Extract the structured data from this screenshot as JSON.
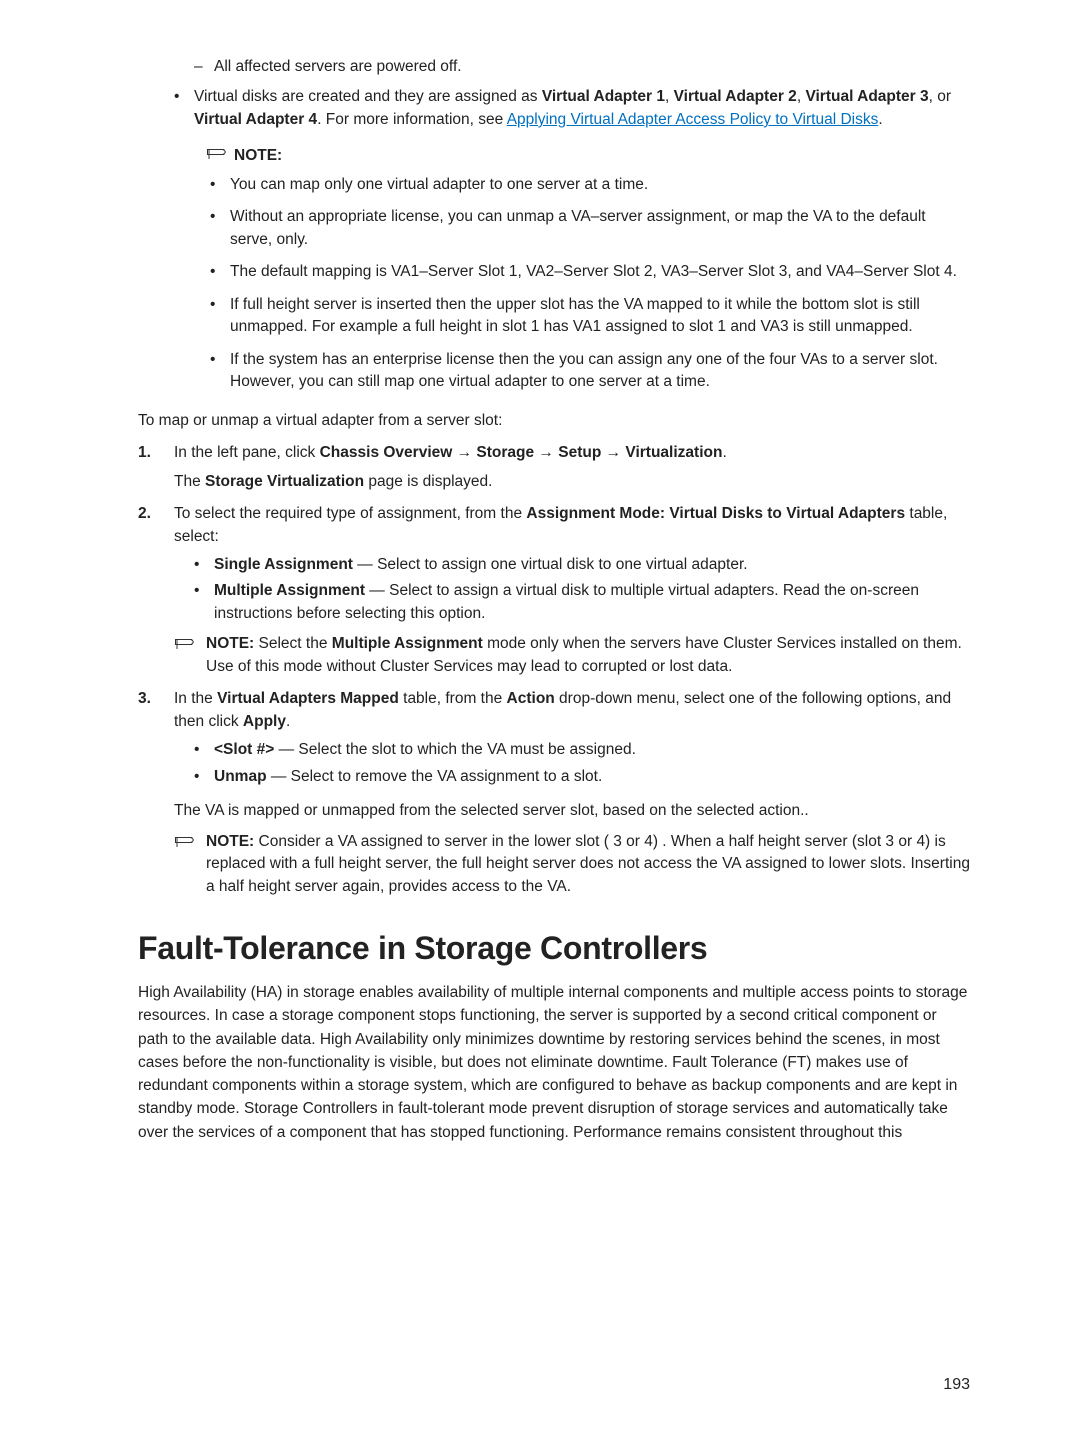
{
  "icons": {
    "pencil_alt": "Note pencil icon"
  },
  "sublist": {
    "item1": "All affected servers are powered off."
  },
  "top": {
    "vd_pre": "Virtual disks are created and they are assigned as ",
    "va1": "Virtual Adapter 1",
    "va2": "Virtual Adapter 2",
    "va3": "Virtual Adapter 3",
    "va4": "Virtual Adapter 4",
    "more_info": ". For more information, see ",
    "link_text": "Applying Virtual Adapter Access Policy to Virtual Disks",
    "period": "."
  },
  "note1": {
    "label": "NOTE:",
    "items": [
      "You can map only one virtual adapter to one server at a time.",
      "Without an appropriate license, you can unmap a VA–server assignment, or map the VA to the default serve, only.",
      "The default mapping is VA1–Server Slot 1, VA2–Server Slot 2, VA3–Server Slot 3, and VA4–Server Slot 4.",
      "If full height server is inserted then the upper slot has the VA mapped to it while the bottom slot is still unmapped. For example a full height in slot 1 has VA1 assigned to slot 1 and VA3 is still unmapped.",
      "If the system has an enterprise license then the you can assign any one of the four VAs to a server slot. However, you can still map one virtual adapter to one server at a time."
    ]
  },
  "intro": "To map or unmap a virtual adapter from a server slot:",
  "steps": {
    "s1": {
      "pre": "In the left pane, click ",
      "path": "Chassis Overview → Storage → Setup → Virtualization",
      "post": ".",
      "line2_pre": "The ",
      "line2_bold": "Storage Virtualization",
      "line2_post": " page is displayed."
    },
    "s2": {
      "pre": "To select the required type of assignment, from the ",
      "bold1": "Assignment Mode: Virtual Disks to Virtual Adapters",
      "post": " table, select:",
      "b1_lbl": "Single Assignment",
      "b1_txt": " — Select to assign one virtual disk to one virtual adapter.",
      "b2_lbl": "Multiple Assignment",
      "b2_txt": " — Select to assign a virtual disk to multiple virtual adapters. Read the on-screen instructions before selecting this option.",
      "note_lbl": "NOTE: ",
      "note_pre": "Select the ",
      "note_bold": "Multiple Assignment",
      "note_post": " mode only when the servers have Cluster Services installed on them. Use of this mode without Cluster Services may lead to corrupted or lost data."
    },
    "s3": {
      "pre": "In the ",
      "bold1": "Virtual Adapters Mapped",
      "mid1": " table, from the ",
      "bold2": "Action",
      "mid2": " drop-down menu, select one of the following options, and then click ",
      "bold3": "Apply",
      "post": ".",
      "b1_lbl": "<Slot #>",
      "b1_txt": " — Select the slot to which the VA must be assigned.",
      "b2_lbl": "Unmap",
      "b2_txt": " — Select to remove the VA assignment to a slot.",
      "result": "The VA is mapped or unmapped from the selected server slot, based on the selected action..",
      "note_lbl": "NOTE: ",
      "note_txt": "Consider a VA assigned to server in the lower slot ( 3 or 4) . When a half height server (slot 3 or 4) is replaced with a full height server, the full height server does not access the VA assigned to lower slots. Inserting a half height server again, provides access to the VA."
    }
  },
  "section": {
    "heading": "Fault-Tolerance in Storage Controllers",
    "para": "High Availability (HA) in storage enables availability of multiple internal components and multiple access points to storage resources. In case a storage component stops functioning, the server is supported by a second critical component or path to the available data. High Availability only minimizes downtime by restoring services behind the scenes, in most cases before the non-functionality is visible, but does not eliminate downtime. Fault Tolerance (FT) makes use of redundant components within a storage system, which are configured to behave as backup components and are kept in standby mode. Storage Controllers in fault-tolerant mode prevent disruption of storage services and automatically take over the services of a component that has stopped functioning. Performance remains consistent throughout this"
  },
  "pagenum": "193"
}
